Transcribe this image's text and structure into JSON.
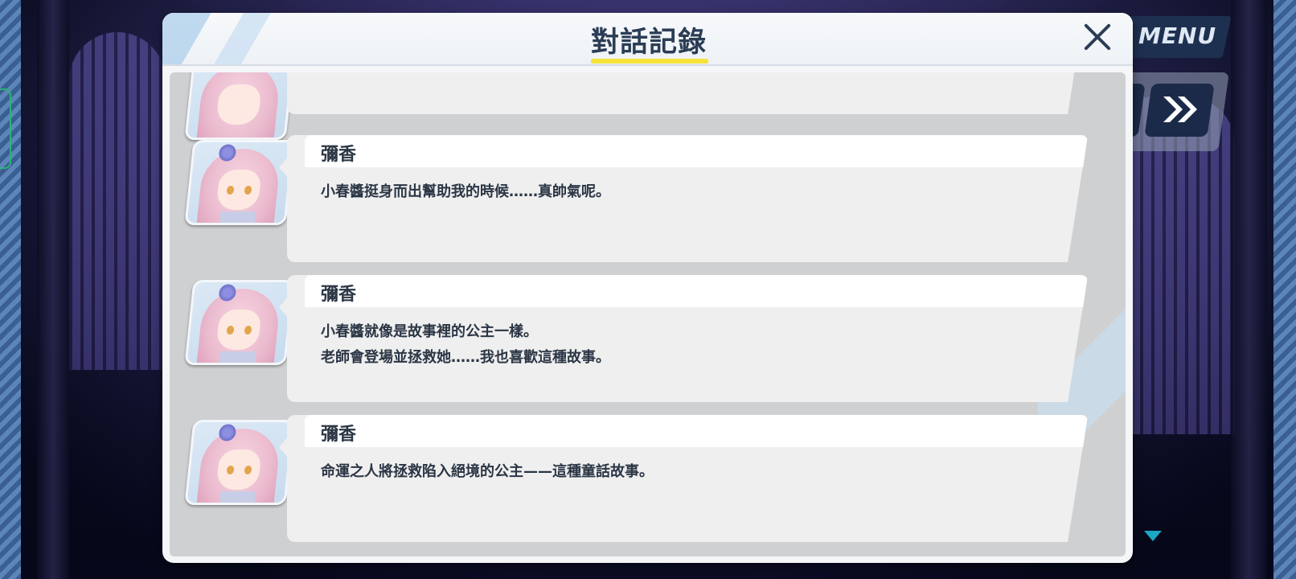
{
  "dialog": {
    "title": "對話記錄"
  },
  "hud": {
    "menu_label": "MENU",
    "fast_forward_icon": "double-chevron-right-icon",
    "scroll_icon": "triangle-down-icon",
    "accent_color": "#f5e33c"
  },
  "log": {
    "entries": [
      {
        "speaker": "",
        "lines": []
      },
      {
        "speaker": "彌香",
        "lines": [
          "小春醬挺身而出幫助我的時候……真帥氣呢。"
        ]
      },
      {
        "speaker": "彌香",
        "lines": [
          "小春醬就像是故事裡的公主一樣。",
          "老師會登場並拯救她……我也喜歡這種故事。"
        ]
      },
      {
        "speaker": "彌香",
        "lines": [
          "命運之人將拯救陷入絕境的公主——這種童話故事。"
        ]
      }
    ]
  }
}
